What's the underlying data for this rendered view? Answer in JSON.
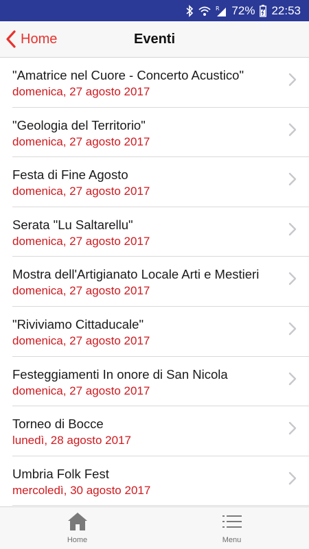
{
  "status_bar": {
    "battery_percent": "72%",
    "time": "22:53",
    "icons": [
      "bluetooth-icon",
      "wifi-icon",
      "signal-icon",
      "battery-icon"
    ]
  },
  "nav": {
    "back_label": "Home",
    "title": "Eventi"
  },
  "events": [
    {
      "title": "\"Amatrice nel Cuore - Concerto Acustico\"",
      "date": "domenica, 27 agosto 2017"
    },
    {
      "title": "\"Geologia del Territorio\"",
      "date": "domenica, 27 agosto 2017"
    },
    {
      "title": "Festa di Fine Agosto",
      "date": "domenica, 27 agosto 2017"
    },
    {
      "title": "Serata \"Lu Saltarellu\"",
      "date": "domenica, 27 agosto 2017"
    },
    {
      "title": "Mostra dell'Artigianato Locale Arti e Mestieri",
      "date": "domenica, 27 agosto 2017"
    },
    {
      "title": "\"Riviviamo Cittaducale\"",
      "date": "domenica, 27 agosto 2017"
    },
    {
      "title": "Festeggiamenti In onore di San Nicola",
      "date": "domenica, 27 agosto 2017"
    },
    {
      "title": "Torneo di Bocce",
      "date": "lunedì, 28 agosto 2017"
    },
    {
      "title": "Umbria Folk Fest",
      "date": "mercoledì, 30 agosto 2017"
    }
  ],
  "tabbar": {
    "tabs": [
      {
        "label": "Home",
        "icon": "home-icon"
      },
      {
        "label": "Menu",
        "icon": "list-menu-icon"
      }
    ]
  },
  "colors": {
    "status_bar_bg": "#2b3a97",
    "accent_red": "#e8322e",
    "date_red": "#d0191e",
    "bar_bg": "#f7f7f7",
    "divider": "#d9d9d9"
  }
}
